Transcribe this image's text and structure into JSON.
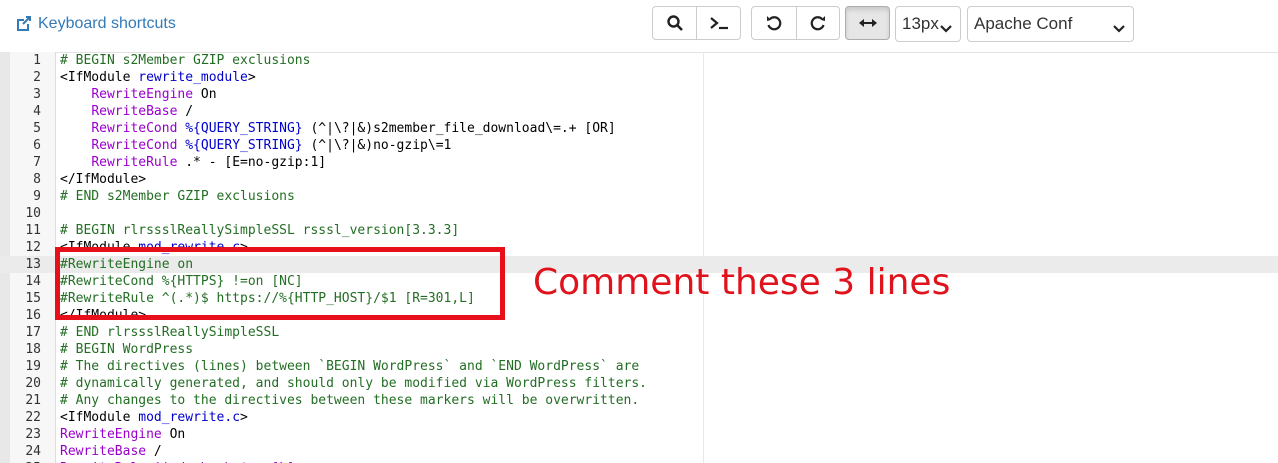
{
  "toolbar": {
    "keyboard_shortcuts_label": "Keyboard shortcuts",
    "font_size": "13px",
    "mode": "Apache Conf"
  },
  "editor": {
    "lines": [
      {
        "num": "1",
        "tokens": [
          {
            "t": "# BEGIN s2Member GZIP exclusions",
            "c": "c-comment"
          }
        ]
      },
      {
        "num": "2",
        "tokens": [
          {
            "t": "<IfModule ",
            "c": "c-tag"
          },
          {
            "t": "rewrite_module",
            "c": "c-var"
          },
          {
            "t": ">",
            "c": "c-tag"
          }
        ]
      },
      {
        "num": "3",
        "tokens": [
          {
            "t": "    ",
            "c": "c-plain"
          },
          {
            "t": "RewriteEngine",
            "c": "c-dir"
          },
          {
            "t": " On",
            "c": "c-plain"
          }
        ]
      },
      {
        "num": "4",
        "tokens": [
          {
            "t": "    ",
            "c": "c-plain"
          },
          {
            "t": "RewriteBase",
            "c": "c-dir"
          },
          {
            "t": " /",
            "c": "c-plain"
          }
        ]
      },
      {
        "num": "5",
        "tokens": [
          {
            "t": "    ",
            "c": "c-plain"
          },
          {
            "t": "RewriteCond",
            "c": "c-dir"
          },
          {
            "t": " ",
            "c": "c-plain"
          },
          {
            "t": "%{QUERY_STRING}",
            "c": "c-var"
          },
          {
            "t": " (^|\\?|&)s2member_file_download\\=.+ [OR]",
            "c": "c-plain"
          }
        ]
      },
      {
        "num": "6",
        "tokens": [
          {
            "t": "    ",
            "c": "c-plain"
          },
          {
            "t": "RewriteCond",
            "c": "c-dir"
          },
          {
            "t": " ",
            "c": "c-plain"
          },
          {
            "t": "%{QUERY_STRING}",
            "c": "c-var"
          },
          {
            "t": " (^|\\?|&)no-gzip\\=1",
            "c": "c-plain"
          }
        ]
      },
      {
        "num": "7",
        "tokens": [
          {
            "t": "    ",
            "c": "c-plain"
          },
          {
            "t": "RewriteRule",
            "c": "c-dir"
          },
          {
            "t": " .* - [E=no-gzip:1]",
            "c": "c-plain"
          }
        ]
      },
      {
        "num": "8",
        "tokens": [
          {
            "t": "</IfModule>",
            "c": "c-tag"
          }
        ]
      },
      {
        "num": "9",
        "tokens": [
          {
            "t": "# END s2Member GZIP exclusions",
            "c": "c-comment"
          }
        ]
      },
      {
        "num": "10",
        "tokens": []
      },
      {
        "num": "11",
        "tokens": [
          {
            "t": "# BEGIN rlrssslReallySimpleSSL rsssl_version[3.3.3]",
            "c": "c-comment"
          }
        ]
      },
      {
        "num": "12",
        "tokens": [
          {
            "t": "<IfModule ",
            "c": "c-tag"
          },
          {
            "t": "mod_rewrite.c",
            "c": "c-var"
          },
          {
            "t": ">",
            "c": "c-tag"
          }
        ]
      },
      {
        "num": "13",
        "tokens": [
          {
            "t": "#RewriteEngine on",
            "c": "c-comment"
          }
        ]
      },
      {
        "num": "14",
        "tokens": [
          {
            "t": "#RewriteCond %{HTTPS} !=on [NC]",
            "c": "c-comment"
          }
        ]
      },
      {
        "num": "15",
        "tokens": [
          {
            "t": "#RewriteRule ^(.*)$ https://%{HTTP_HOST}/$1 [R=301,L]",
            "c": "c-comment"
          }
        ]
      },
      {
        "num": "16",
        "tokens": [
          {
            "t": "</IfModule>",
            "c": "c-tag"
          }
        ]
      },
      {
        "num": "17",
        "tokens": [
          {
            "t": "# END rlrssslReallySimpleSSL",
            "c": "c-comment"
          }
        ]
      },
      {
        "num": "18",
        "tokens": [
          {
            "t": "# BEGIN WordPress",
            "c": "c-comment"
          }
        ]
      },
      {
        "num": "19",
        "tokens": [
          {
            "t": "# The directives (lines) between `BEGIN WordPress` and `END WordPress` are",
            "c": "c-comment"
          }
        ]
      },
      {
        "num": "20",
        "tokens": [
          {
            "t": "# dynamically generated, and should only be modified via WordPress filters.",
            "c": "c-comment"
          }
        ]
      },
      {
        "num": "21",
        "tokens": [
          {
            "t": "# Any changes to the directives between these markers will be overwritten.",
            "c": "c-comment"
          }
        ]
      },
      {
        "num": "22",
        "tokens": [
          {
            "t": "<IfModule ",
            "c": "c-tag"
          },
          {
            "t": "mod_rewrite.c",
            "c": "c-var"
          },
          {
            "t": ">",
            "c": "c-tag"
          }
        ]
      },
      {
        "num": "23",
        "tokens": [
          {
            "t": "RewriteEngine",
            "c": "c-dir"
          },
          {
            "t": " On",
            "c": "c-plain"
          }
        ]
      },
      {
        "num": "24",
        "tokens": [
          {
            "t": "RewriteBase",
            "c": "c-dir"
          },
          {
            "t": " /",
            "c": "c-plain"
          }
        ]
      },
      {
        "num": "25",
        "tokens": [
          {
            "t": "RewriteRule ^index\\.php$ - [L]",
            "c": "c-dir"
          }
        ]
      }
    ],
    "active_line": "13"
  },
  "annotation": {
    "text": "Comment these 3 lines",
    "color": "#e60f1a"
  }
}
